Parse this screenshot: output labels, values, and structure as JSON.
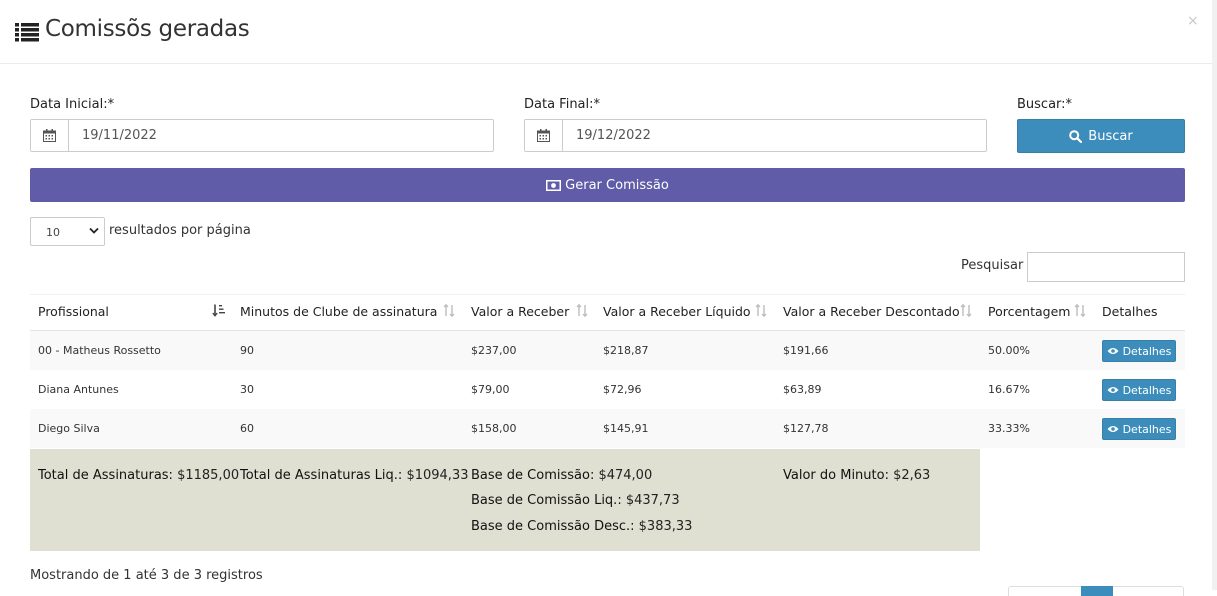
{
  "modal": {
    "title": "Comissõs geradas",
    "close_label": "×"
  },
  "filters": {
    "start_label": "Data Inicial:*",
    "start_value": "19/11/2022",
    "end_label": "Data Final:*",
    "end_value": "19/12/2022",
    "search_label": "Buscar:*",
    "search_button": "Buscar"
  },
  "generate_button": "Gerar Comissão",
  "table_controls": {
    "page_length": "10",
    "page_length_label": "resultados por página",
    "search_label": "Pesquisar",
    "search_value": ""
  },
  "columns": [
    "Profissional",
    "Minutos de Clube de assinatura",
    "Valor a Receber",
    "Valor a Receber Líquido",
    "Valor a Receber Descontado",
    "Porcentagem",
    "Detalhes"
  ],
  "rows": [
    {
      "profissional": "00 - Matheus Rossetto",
      "minutos": "90",
      "valor": "$237,00",
      "liquido": "$218,87",
      "descontado": "$191,66",
      "porcentagem": "50.00%",
      "detalhes": "Detalhes"
    },
    {
      "profissional": "Diana Antunes",
      "minutos": "30",
      "valor": "$79,00",
      "liquido": "$72,96",
      "descontado": "$63,89",
      "porcentagem": "16.67%",
      "detalhes": "Detalhes"
    },
    {
      "profissional": "Diego Silva",
      "minutos": "60",
      "valor": "$158,00",
      "liquido": "$145,91",
      "descontado": "$127,78",
      "porcentagem": "33.33%",
      "detalhes": "Detalhes"
    }
  ],
  "totals": {
    "assinaturas_label": "Total de Assinaturas:",
    "assinaturas_value": "$1185,00",
    "assinaturas_liq_label": "Total de Assinaturas Liq.:",
    "assinaturas_liq_value": "$1094,33",
    "base_label": "Base de Comissão:",
    "base_value": "$474,00",
    "base_liq_label": "Base de Comissão Liq.:",
    "base_liq_value": "$437,73",
    "base_desc_label": "Base de Comissão Desc.:",
    "base_desc_value": "$383,33",
    "minuto_label": "Valor do Minuto:",
    "minuto_value": "$2,63"
  },
  "info": "Mostrando de 1 até 3 de 3 registros",
  "colors": {
    "primary": "#3c8dbc",
    "purple": "#605ca8",
    "totals_bg": "#dfe0d2"
  }
}
